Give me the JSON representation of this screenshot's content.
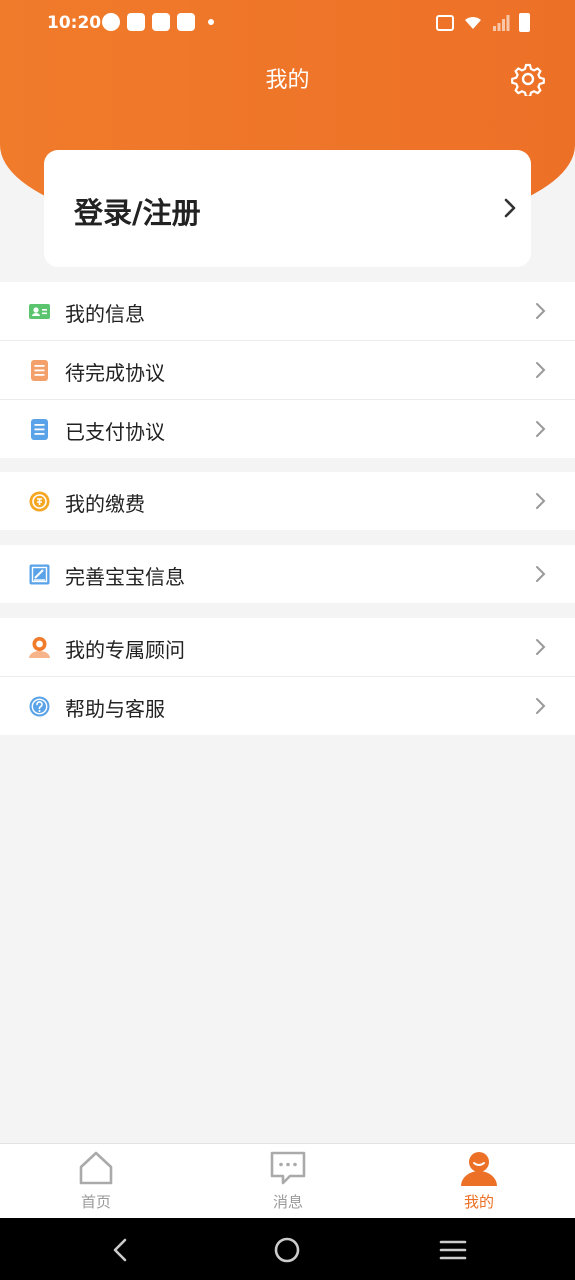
{
  "status_bar": {
    "time": "10:20"
  },
  "header": {
    "title": "我的"
  },
  "login": {
    "label": "登录/注册"
  },
  "menu_groups": [
    {
      "items": [
        {
          "label": "我的信息",
          "icon": "id-card-icon",
          "color": "#5bc46e"
        },
        {
          "label": "待完成协议",
          "icon": "document-icon",
          "color": "#f4a06a"
        },
        {
          "label": "已支付协议",
          "icon": "document-icon",
          "color": "#5aa3e8"
        }
      ]
    },
    {
      "items": [
        {
          "label": "我的缴费",
          "icon": "coin-icon",
          "color": "#f5a623"
        }
      ]
    },
    {
      "items": [
        {
          "label": "完善宝宝信息",
          "icon": "edit-icon",
          "color": "#5aa3e8"
        }
      ]
    },
    {
      "items": [
        {
          "label": "我的专属顾问",
          "icon": "advisor-icon",
          "color": "#f07b2b"
        },
        {
          "label": "帮助与客服",
          "icon": "help-icon",
          "color": "#5aa3e8"
        }
      ]
    }
  ],
  "tabs": [
    {
      "label": "首页",
      "icon": "home-icon",
      "active": false
    },
    {
      "label": "消息",
      "icon": "message-icon",
      "active": false
    },
    {
      "label": "我的",
      "icon": "profile-icon",
      "active": true
    }
  ],
  "colors": {
    "accent": "#ef7a2a",
    "background": "#f4f4f4"
  }
}
